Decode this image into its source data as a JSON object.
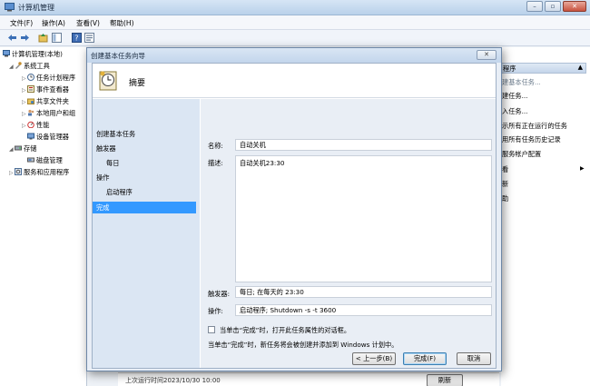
{
  "window": {
    "title": "计算机管理"
  },
  "menu": [
    "文件(F)",
    "操作(A)",
    "查看(V)",
    "帮助(H)"
  ],
  "tree": {
    "root": "计算机管理(本地)",
    "system_tools": "系统工具",
    "items": [
      "任务计划程序",
      "事件查看器",
      "共享文件夹",
      "本地用户和组",
      "性能",
      "设备管理器"
    ],
    "storage": "存储",
    "disk": "磁盘管理",
    "services": "服务和应用程序"
  },
  "actions": {
    "header": "程序",
    "items": [
      "建基本任务...",
      "建任务...",
      "入任务...",
      "示所有正在运行的任务",
      "用所有任务历史记录",
      "服务帐户配置",
      "看",
      "新",
      "助"
    ]
  },
  "dialog": {
    "title": "创建基本任务向导",
    "close": "✕",
    "heading": "摘要",
    "steps": [
      "创建基本任务",
      "触发器",
      "每日",
      "操作",
      "启动程序",
      "完成"
    ],
    "name_label": "名称:",
    "name_value": "自动关机",
    "desc_label": "描述:",
    "desc_value": "自动关机23:30",
    "trigger_label": "触发器:",
    "trigger_value": "每日; 在每天的 23:30",
    "action_label": "操作:",
    "action_value": "启动程序; Shutdown -s -t 3600",
    "checkbox_label": "当单击“完成”时，打开此任务属性的对话框。",
    "note": "当单击“完成”时，新任务将会被创建并添加到 Windows 计划中。",
    "back": "< 上一步(B)",
    "finish": "完成(F)",
    "cancel": "取消"
  },
  "bottom": {
    "text": "上次运行时间2023/10/30 10:00",
    "button": "刷新"
  }
}
